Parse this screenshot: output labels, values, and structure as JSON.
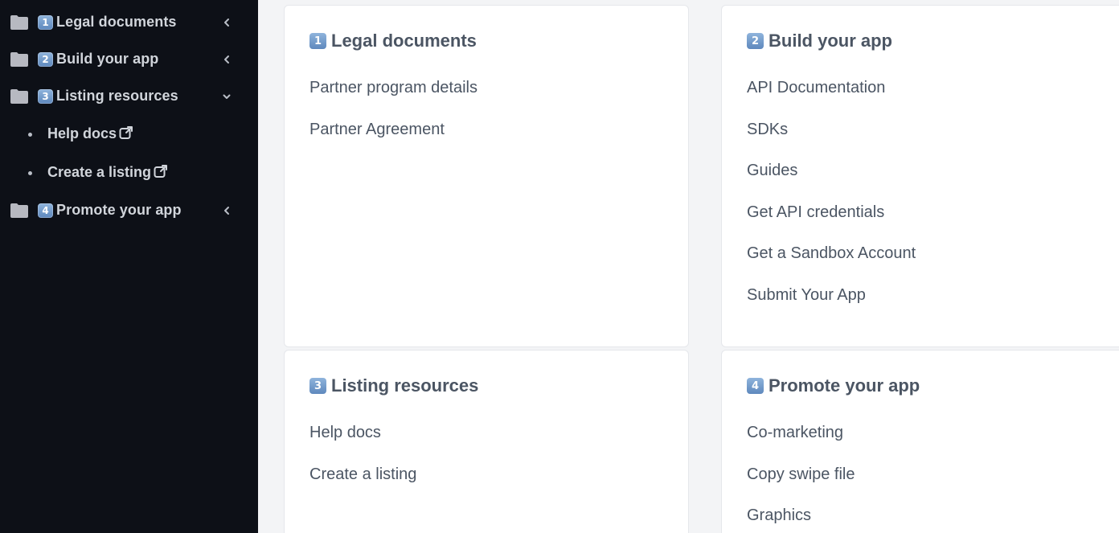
{
  "sidebar": {
    "items": [
      {
        "num": "1",
        "label": "Legal documents",
        "expanded": false
      },
      {
        "num": "2",
        "label": "Build your app",
        "expanded": false
      },
      {
        "num": "3",
        "label": "Listing resources",
        "expanded": true,
        "children": [
          {
            "label": "Help docs",
            "icon": "external-link-icon"
          },
          {
            "label": "Create a listing",
            "icon": "external-link-icon"
          }
        ]
      },
      {
        "num": "4",
        "label": "Promote your app",
        "expanded": false
      }
    ],
    "icons": {
      "folder": "folder-icon",
      "collapsed": "chevron-left-icon",
      "expanded": "chevron-down-icon"
    }
  },
  "cards": [
    {
      "num": "1",
      "title": "Legal documents",
      "links": [
        "Partner program details",
        "Partner Agreement"
      ]
    },
    {
      "num": "2",
      "title": "Build your app",
      "links": [
        "API Documentation",
        "SDKs",
        "Guides",
        "Get API credentials",
        "Get a Sandbox Account",
        "Submit Your App"
      ]
    },
    {
      "num": "3",
      "title": "Listing resources",
      "links": [
        "Help docs",
        "Create a listing"
      ]
    },
    {
      "num": "4",
      "title": "Promote your app",
      "links": [
        "Co-marketing",
        "Copy swipe file",
        "Graphics"
      ]
    }
  ],
  "colors": {
    "sidebar_bg": "#0d1017",
    "sidebar_text": "#d1d5db",
    "page_bg": "#f3f4f6",
    "card_bg": "#ffffff",
    "text": "#4b5563",
    "badge": "#5e88bd"
  }
}
